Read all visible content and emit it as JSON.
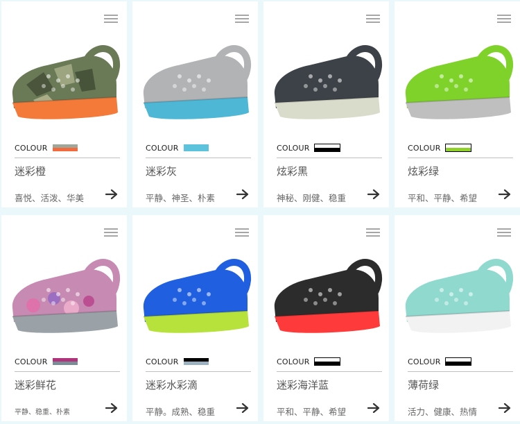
{
  "products": [
    {
      "colour_label": "COLOUR",
      "name": "迷彩橙",
      "tags": "喜悦、活泼、华美",
      "swatch": [
        "#9fa69a",
        "#f26a3d"
      ],
      "upper": "#6b7a56",
      "sole": "#f47a3a",
      "pattern": "camo",
      "shoe_icon": "clog-shoe-icon"
    },
    {
      "colour_label": "COLOUR",
      "name": "迷彩灰",
      "tags": "平静、神圣、朴素",
      "swatch": [
        "#5dc3dd",
        "#5dc3dd"
      ],
      "upper": "#b1b3b5",
      "sole": "#4fb7d6",
      "pattern": "plain",
      "shoe_icon": "clog-shoe-icon"
    },
    {
      "colour_label": "COLOUR",
      "name": "炫彩黑",
      "tags": "神秘、刚健、稳重",
      "swatch": [
        "#ffffff",
        "#000000"
      ],
      "upper": "#3d4248",
      "sole": "#d9dccb",
      "pattern": "plain",
      "shoe_icon": "clog-shoe-icon"
    },
    {
      "colour_label": "COLOUR",
      "name": "炫彩绿",
      "tags": "平和、平静、希望",
      "swatch": [
        "#ffffff",
        "#8fd129"
      ],
      "upper": "#7fd22a",
      "sole": "#bfbfbf",
      "pattern": "plain",
      "shoe_icon": "clog-shoe-icon"
    },
    {
      "colour_label": "COLOUR",
      "name": "迷彩鲜花",
      "tags": "平静、稳重、朴素",
      "swatch": [
        "#b0327b",
        "#7a8d96"
      ],
      "upper": "#c78ab2",
      "sole": "#9aa2a8",
      "pattern": "floral",
      "shoe_icon": "clog-shoe-icon"
    },
    {
      "colour_label": "COLOUR",
      "name": "迷彩水彩滴",
      "tags": "平静。成熟、稳重",
      "swatch": [
        "#000000",
        "#9db2c0"
      ],
      "upper": "#1f5fe0",
      "sole": "#b6e23b",
      "pattern": "plain",
      "shoe_icon": "clog-shoe-icon"
    },
    {
      "colour_label": "COLOUR",
      "name": "迷彩海洋蓝",
      "tags": "平和、平静、希望",
      "swatch": [
        "#ffffff",
        "#000000"
      ],
      "upper": "#2c2c2c",
      "sole": "#ff3a3a",
      "pattern": "plain",
      "shoe_icon": "clog-shoe-icon"
    },
    {
      "colour_label": "COLOUR",
      "name": "薄荷绿",
      "tags": "活力、健康、热情",
      "swatch": [
        "#ffffff",
        "#000000"
      ],
      "upper": "#8fd9cf",
      "sole": "#f2f2f2",
      "pattern": "plain",
      "shoe_icon": "clog-shoe-icon"
    }
  ],
  "arrow_icon": "arrow-right-icon",
  "menu_icon": "hamburger-menu-icon"
}
